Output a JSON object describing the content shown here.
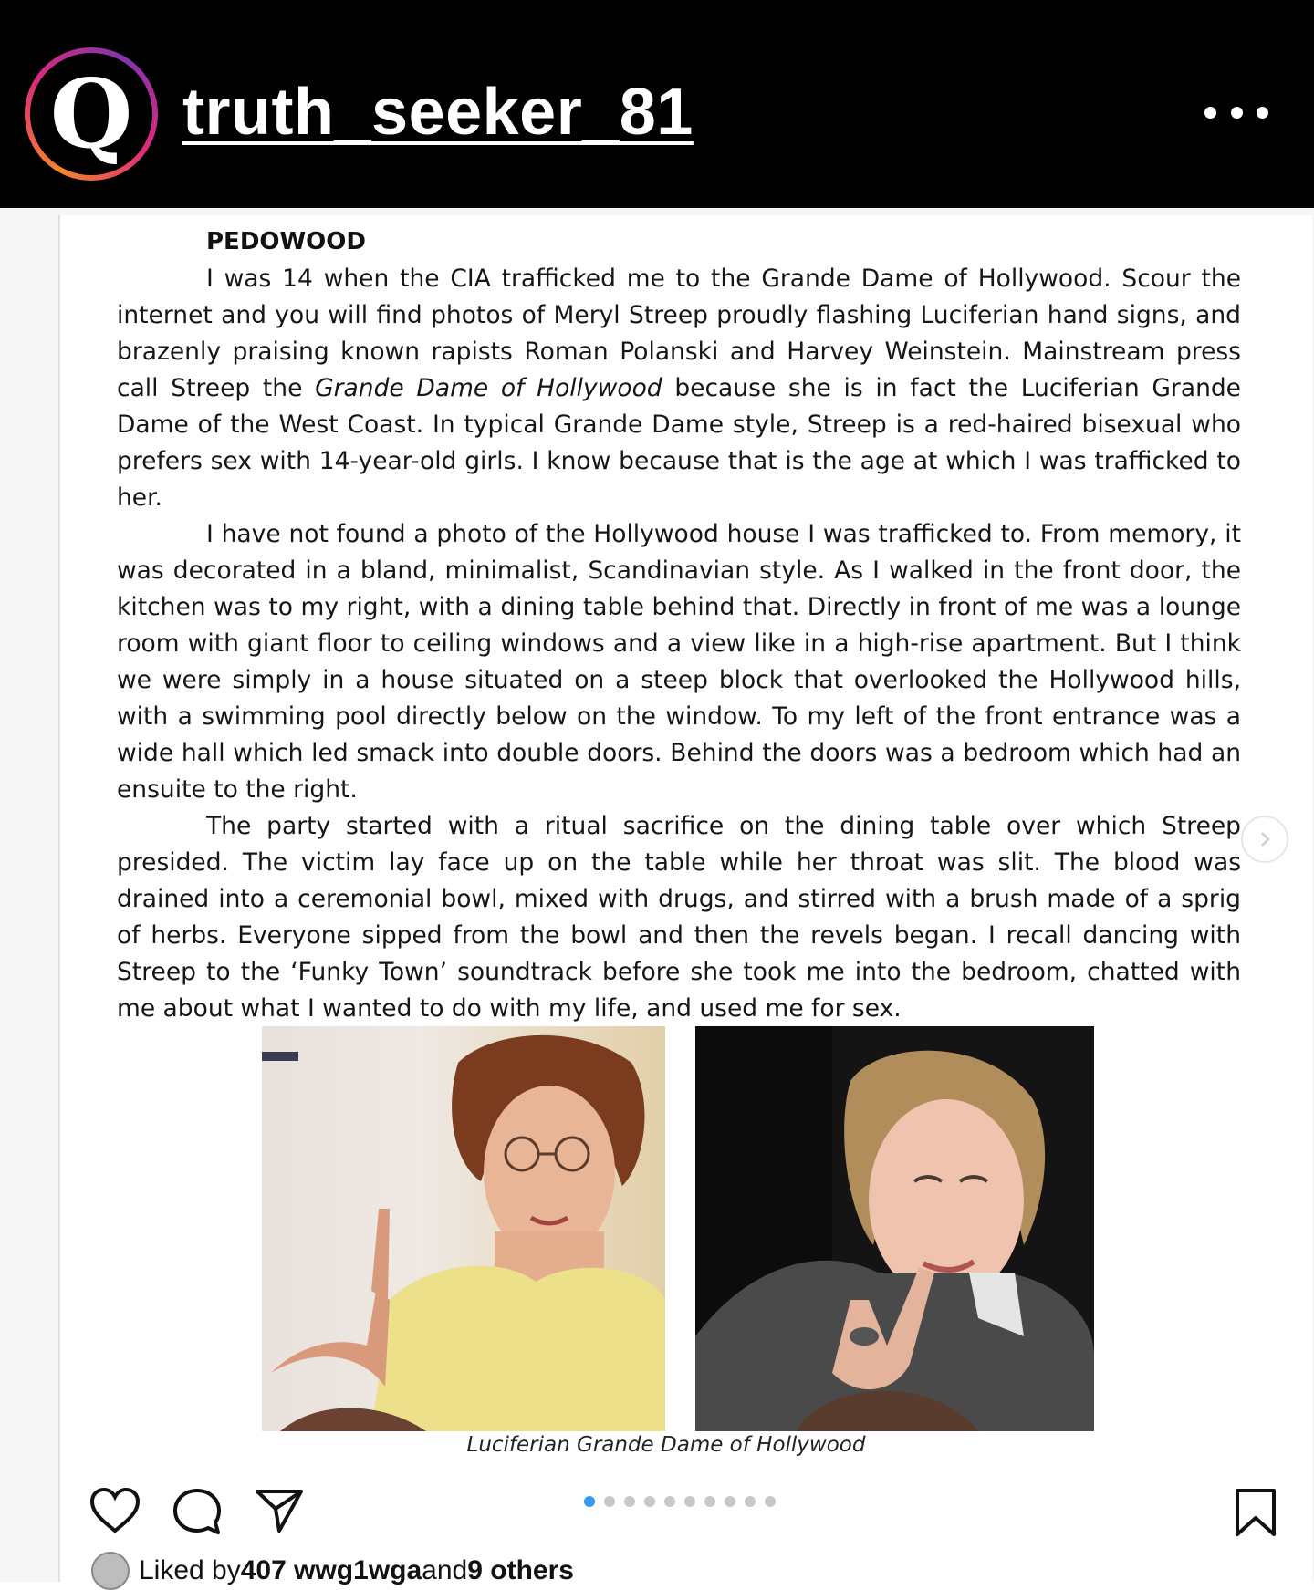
{
  "account": {
    "avatar_letter": "Q",
    "username": "truth_seeker_81"
  },
  "document": {
    "title": "PEDOWOOD",
    "paragraphs": [
      {
        "before_italic": "I was 14 when the CIA trafficked me to the Grande Dame of Hollywood. Scour the internet and you will find photos of Meryl Streep proudly flashing Luciferian hand signs, and brazenly praising known rapists Roman Polanski and Harvey Weinstein. Mainstream press call Streep the ",
        "italic": "Grande Dame of Hollywood",
        "after_italic": " because she is in fact the Luciferian Grande Dame of the West Coast. In typical Grande Dame style, Streep is a red-haired bisexual who prefers sex with 14-year-old girls. I know because that is the age at which I was trafficked to her."
      },
      {
        "text": "I have not found a photo of the Hollywood house I was trafficked to. From memory, it was decorated in a bland, minimalist, Scandinavian style. As I walked in the front door, the kitchen was to my right, with a dining table behind that. Directly in front of me was a lounge room with giant floor to ceiling windows and a view like in a high-rise apartment. But I think we were simply in a house situated on a steep block that overlooked the Hollywood hills, with a swimming pool directly below on the window. To my left of the front entrance was a wide hall which led smack into double doors. Behind the doors was a bedroom which had an ensuite to the right."
      },
      {
        "text": "The party started with a ritual sacrifice on the dining table over which Streep presided. The victim lay face up on the table while her throat was slit. The blood was drained into a ceremonial bowl, mixed with drugs, and stirred with a brush made of a sprig of herbs. Everyone sipped from the bowl and then the revels began. I recall dancing with Streep to the ‘Funky Town’ soundtrack before she took me into the bedroom, chatted with me about what I wanted to do with my life, and used me for sex."
      }
    ],
    "caption": "Luciferian Grande Dame of Hollywood"
  },
  "carousel": {
    "total_dots": 10,
    "active_index": 0
  },
  "likes": {
    "prefix": "Liked by ",
    "user": "407 wwg1wga",
    "middle": " and ",
    "others": "9 others"
  },
  "icons": {
    "more": "more-horizontal-icon",
    "like": "heart-icon",
    "comment": "comment-icon",
    "share": "send-icon",
    "save": "bookmark-icon",
    "next": "chevron-right-icon"
  },
  "colors": {
    "header_bg": "#000000",
    "carousel_active": "#3897f0",
    "carousel_inactive": "#c8c8c8"
  }
}
